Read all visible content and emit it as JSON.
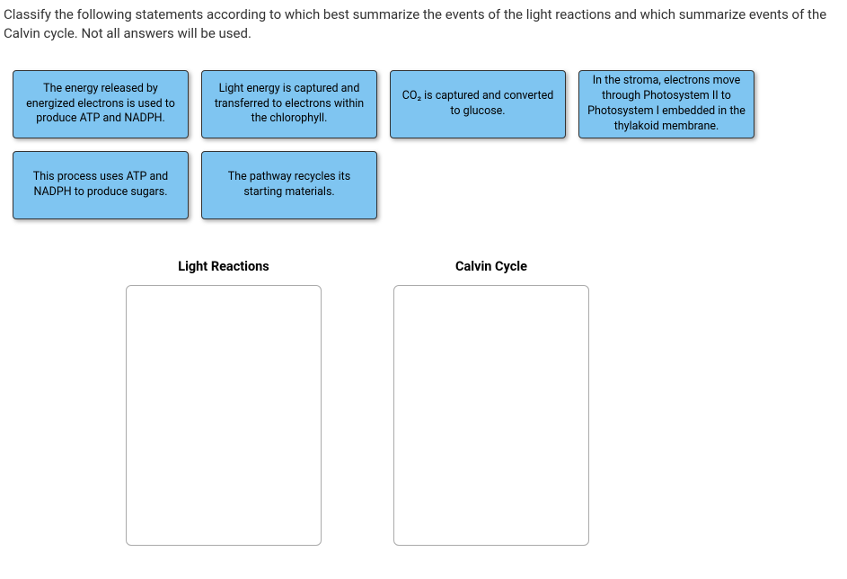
{
  "prompt": "Classify the following statements according to which best summarize the events of the light reactions and which summarize events of the Calvin cycle. Not all answers will be used.",
  "cards": {
    "c1": "The energy released by energized electrons is used to produce ATP and NADPH.",
    "c2": "Light energy is captured and transferred to electrons within the chlorophyll.",
    "c3": "CO₂ is captured and converted to glucose.",
    "c4": "In the stroma, electrons move through Photosystem II to Photosystem I embedded in the thylakoid membrane.",
    "c5": "This process uses ATP and NADPH to produce sugars.",
    "c6": "The pathway recycles its starting materials."
  },
  "dropzones": {
    "light": "Light Reactions",
    "calvin": "Calvin Cycle"
  }
}
